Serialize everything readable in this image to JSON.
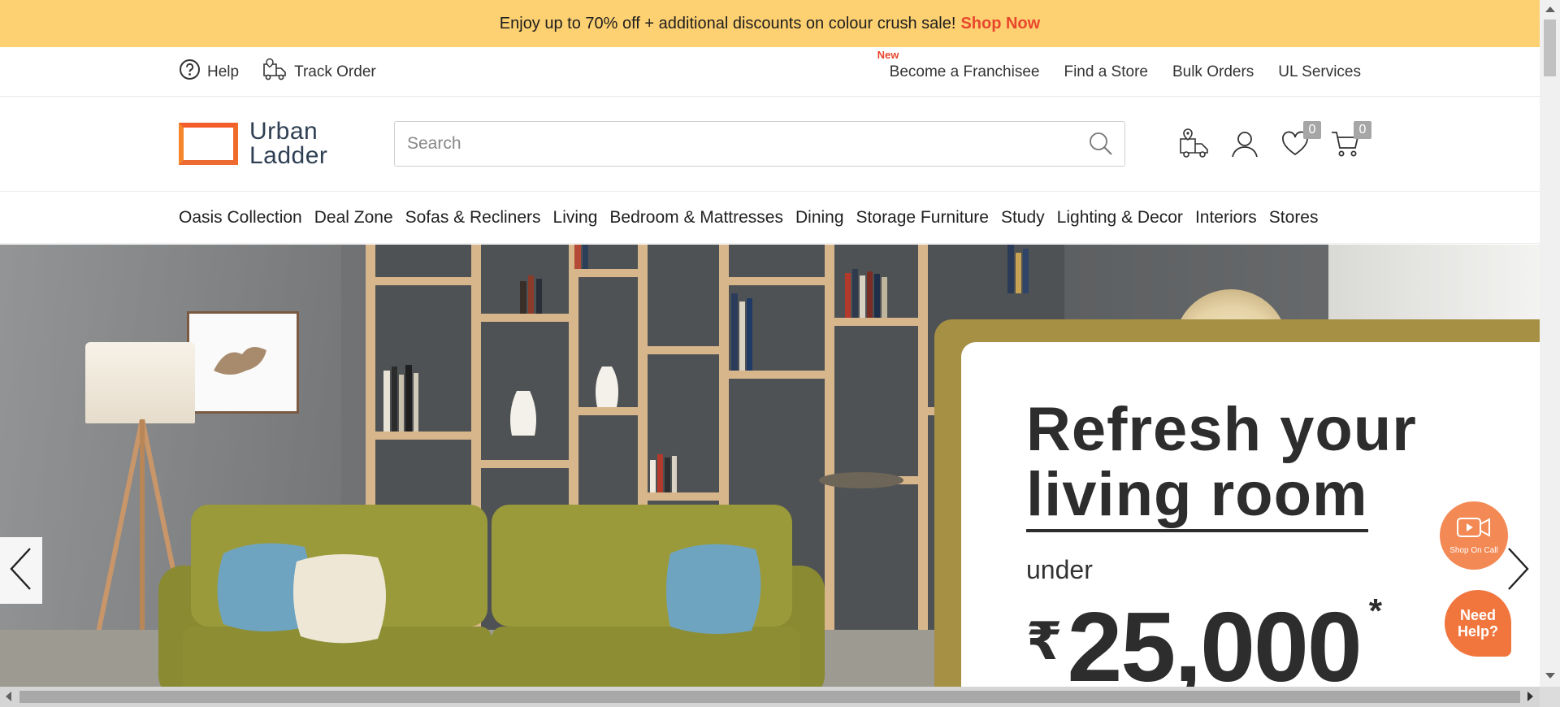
{
  "promo_bar": {
    "text": "Enjoy up to 70% off + additional discounts on colour crush sale!",
    "cta": "Shop Now",
    "bg_color": "#fdd071",
    "cta_color": "#e8472d"
  },
  "utility_bar": {
    "left": [
      {
        "label": "Help",
        "icon": "help-circle-icon"
      },
      {
        "label": "Track Order",
        "icon": "delivery-truck-icon"
      }
    ],
    "right": [
      {
        "label": "Become a Franchisee",
        "badge": "New"
      },
      {
        "label": "Find a Store"
      },
      {
        "label": "Bulk Orders"
      },
      {
        "label": "UL Services"
      }
    ]
  },
  "header": {
    "logo_line1": "Urban",
    "logo_line2": "Ladder",
    "search_placeholder": "Search",
    "wishlist_count": "0",
    "cart_count": "0",
    "icons": [
      "store-locator-truck-icon",
      "user-account-icon",
      "wishlist-heart-icon",
      "cart-icon"
    ]
  },
  "category_nav": [
    "Oasis Collection",
    "Deal Zone",
    "Sofas & Recliners",
    "Living",
    "Bedroom & Mattresses",
    "Dining",
    "Storage Furniture",
    "Study",
    "Lighting & Decor",
    "Interiors",
    "Stores"
  ],
  "hero": {
    "heading_line1": "Refresh your",
    "heading_line2": "living room",
    "subtext": "under",
    "currency": "₹",
    "amount": "25,000",
    "asterisk": "*",
    "card_border_color": "#a59044"
  },
  "floating": {
    "shop_on_call": "Shop On Call",
    "need_help": "Need Help?",
    "accent_color": "#f38a55"
  }
}
